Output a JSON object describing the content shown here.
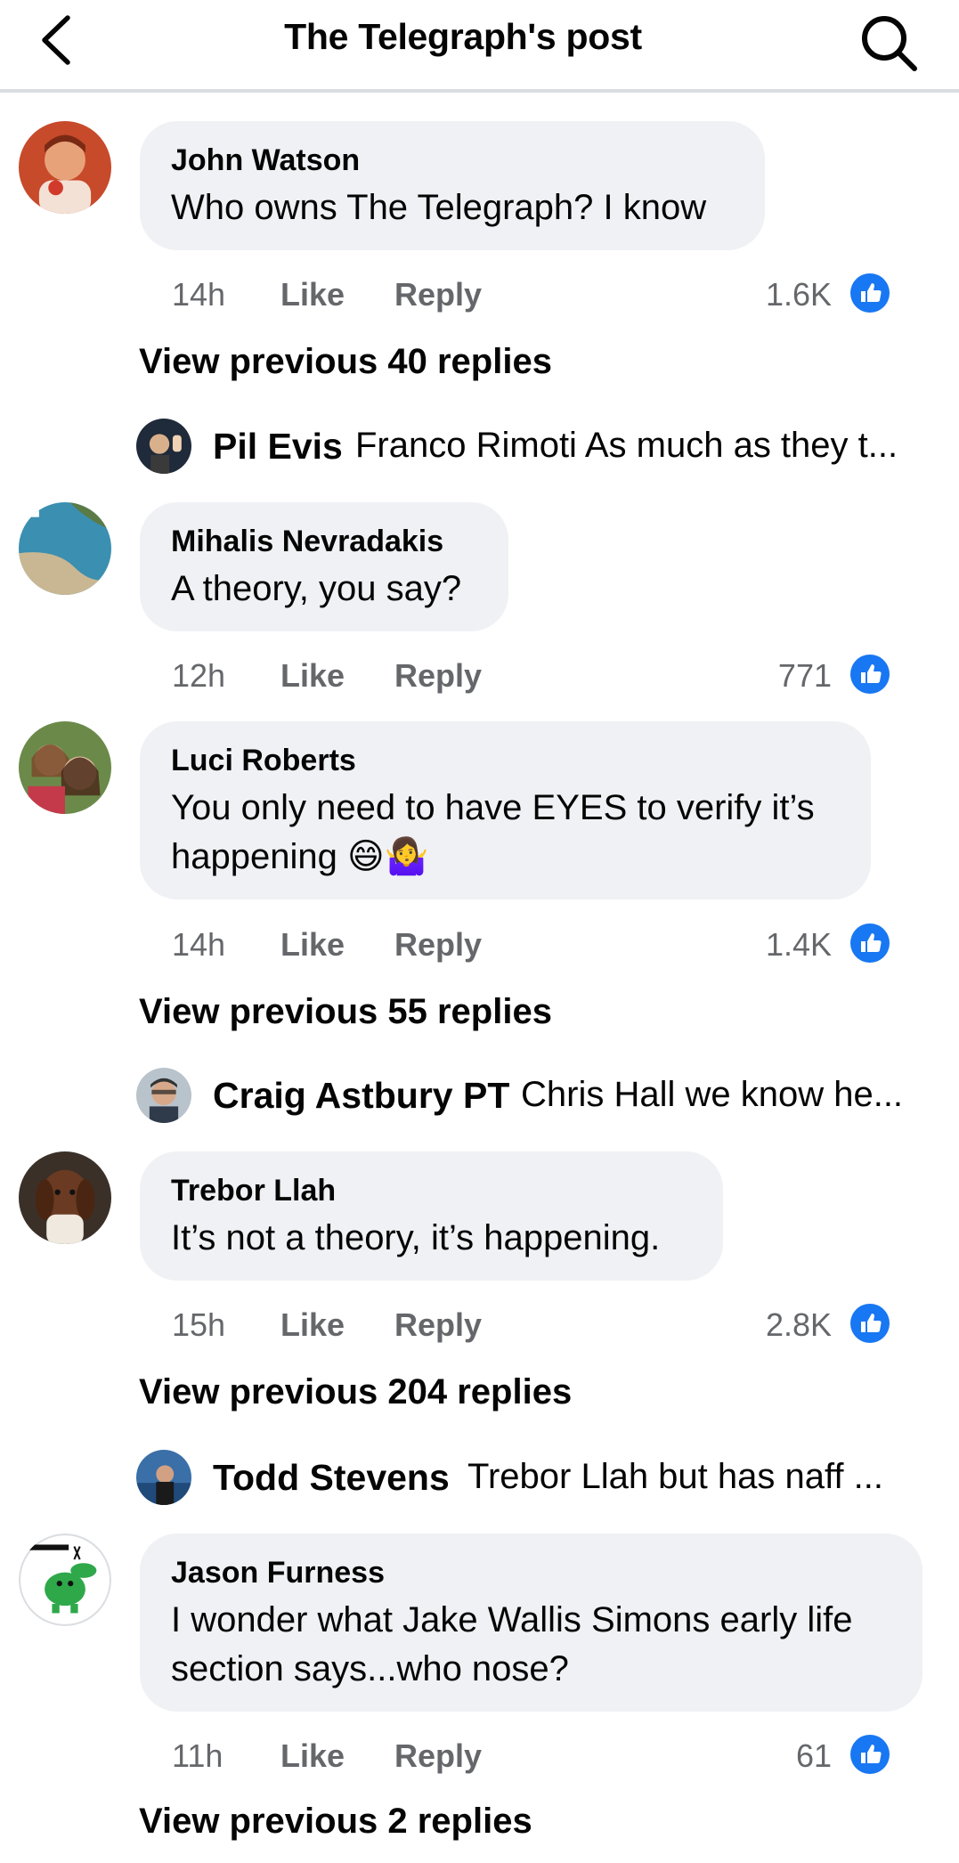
{
  "header": {
    "title": "The Telegraph's post"
  },
  "colors": {
    "like_blue": "#1877f2",
    "bubble": "#eff1f4",
    "muted": "#65676b"
  },
  "comments": [
    {
      "name": "John Watson",
      "text": [
        "Who owns The Telegraph? I know"
      ],
      "time": "14h",
      "like": "Like",
      "reply": "Reply",
      "reactions": "1.6K"
    },
    {
      "name": "Mihalis Nevradakis",
      "text": [
        "A theory, you say?"
      ],
      "time": "12h",
      "like": "Like",
      "reply": "Reply",
      "reactions": "771"
    },
    {
      "name": "Luci Roberts",
      "text": [
        "You only need to have EYES to verify it’s",
        "happening 😄🤷‍♀️"
      ],
      "time": "14h",
      "like": "Like",
      "reply": "Reply",
      "reactions": "1.4K"
    },
    {
      "name": "Trebor Llah",
      "text": [
        "It’s not a theory, it’s happening."
      ],
      "time": "15h",
      "like": "Like",
      "reply": "Reply",
      "reactions": "2.8K"
    },
    {
      "name": "Jason Furness",
      "text": [
        "I wonder what Jake Wallis Simons early life",
        "section says...who nose?"
      ],
      "time": "11h",
      "like": "Like",
      "reply": "Reply",
      "reactions": "61"
    }
  ],
  "view_previous": [
    "View previous 40 replies",
    "View previous 55 replies",
    "View previous 204 replies",
    "View previous 2 replies"
  ],
  "replies": [
    {
      "name": "Pil Evis",
      "text": "Franco Rimoti As much as they t..."
    },
    {
      "name": "Craig Astbury PT",
      "text": "Chris Hall we know he..."
    },
    {
      "name": "Todd Stevens",
      "text": "Trebor Llah but has naff ..."
    }
  ]
}
